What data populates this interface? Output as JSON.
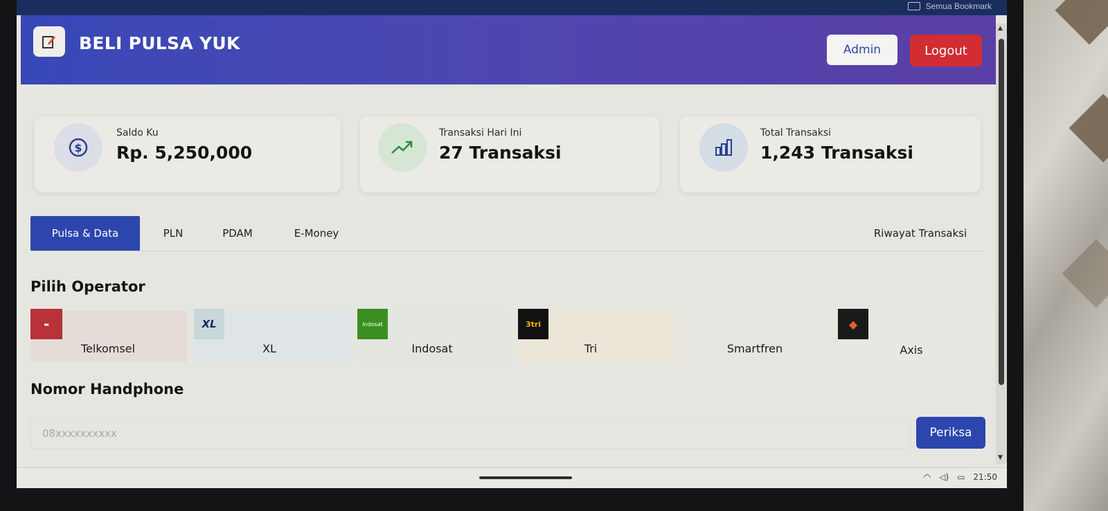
{
  "browser": {
    "bookmarks_all": "Semua Bookmark"
  },
  "header": {
    "title": "BELI PULSA YUK",
    "admin_label": "Admin",
    "logout_label": "Logout"
  },
  "stats": [
    {
      "label": "Saldo Ku",
      "value": "Rp. 5,250,000",
      "icon": "dollar-icon"
    },
    {
      "label": "Transaksi Hari Ini",
      "value": "27 Transaksi",
      "icon": "trending-up-icon"
    },
    {
      "label": "Total Transaksi",
      "value": "1,243 Transaksi",
      "icon": "bar-chart-icon"
    }
  ],
  "tabs": {
    "items": [
      "Pulsa & Data",
      "PLN",
      "PDAM",
      "E-Money"
    ],
    "active": "Pulsa & Data",
    "history_label": "Riwayat Transaksi"
  },
  "operator_section": {
    "title": "Pilih Operator",
    "operators": [
      {
        "name": "Telkomsel",
        "logo_color": "#b8323a"
      },
      {
        "name": "XL",
        "logo_color": "#c8d8da"
      },
      {
        "name": "Indosat",
        "logo_color": "#3b8f22"
      },
      {
        "name": "Tri",
        "logo_color": "#111111"
      },
      {
        "name": "Smartfren",
        "logo_color": ""
      },
      {
        "name": "Axis",
        "logo_color": "#1a1a1a"
      }
    ]
  },
  "phone_section": {
    "title": "Nomor Handphone",
    "placeholder": "08xxxxxxxxxx",
    "check_label": "Periksa"
  },
  "system": {
    "time": "21:50"
  },
  "colors": {
    "primary": "#2c46ad",
    "header_gradient_start": "#3848b8",
    "header_gradient_end": "#5a3fa6",
    "logout": "#d12d33"
  }
}
